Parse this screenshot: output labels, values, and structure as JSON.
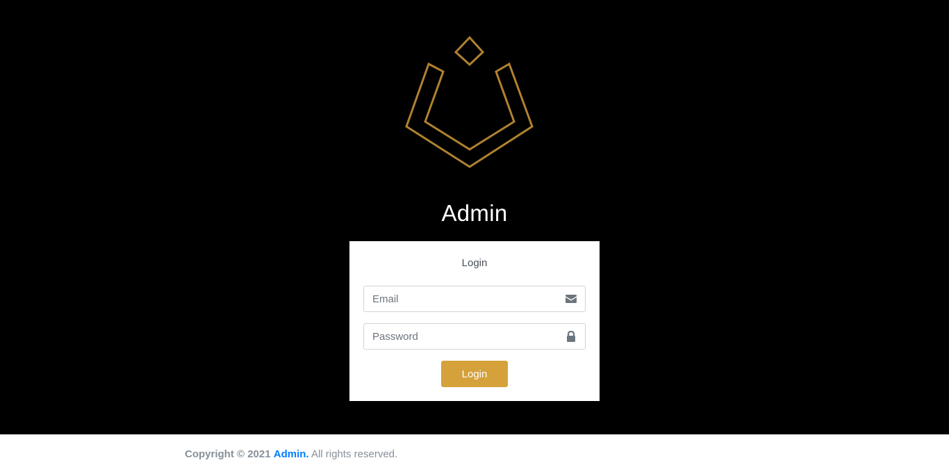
{
  "brand": {
    "title": "Admin",
    "logo_icon": "admin-logo-icon",
    "accent_color": "#b08230"
  },
  "login_card": {
    "title": "Login",
    "email": {
      "placeholder": "Email",
      "value": "",
      "icon": "envelope-icon"
    },
    "password": {
      "placeholder": "Password",
      "value": "",
      "icon": "lock-icon"
    },
    "submit_label": "Login",
    "button_color": "#d4a13a"
  },
  "footer": {
    "copyright_prefix": "Copyright © 2021",
    "brand_link": "Admin.",
    "suffix": "All rights reserved.",
    "link_color": "#007bff"
  }
}
